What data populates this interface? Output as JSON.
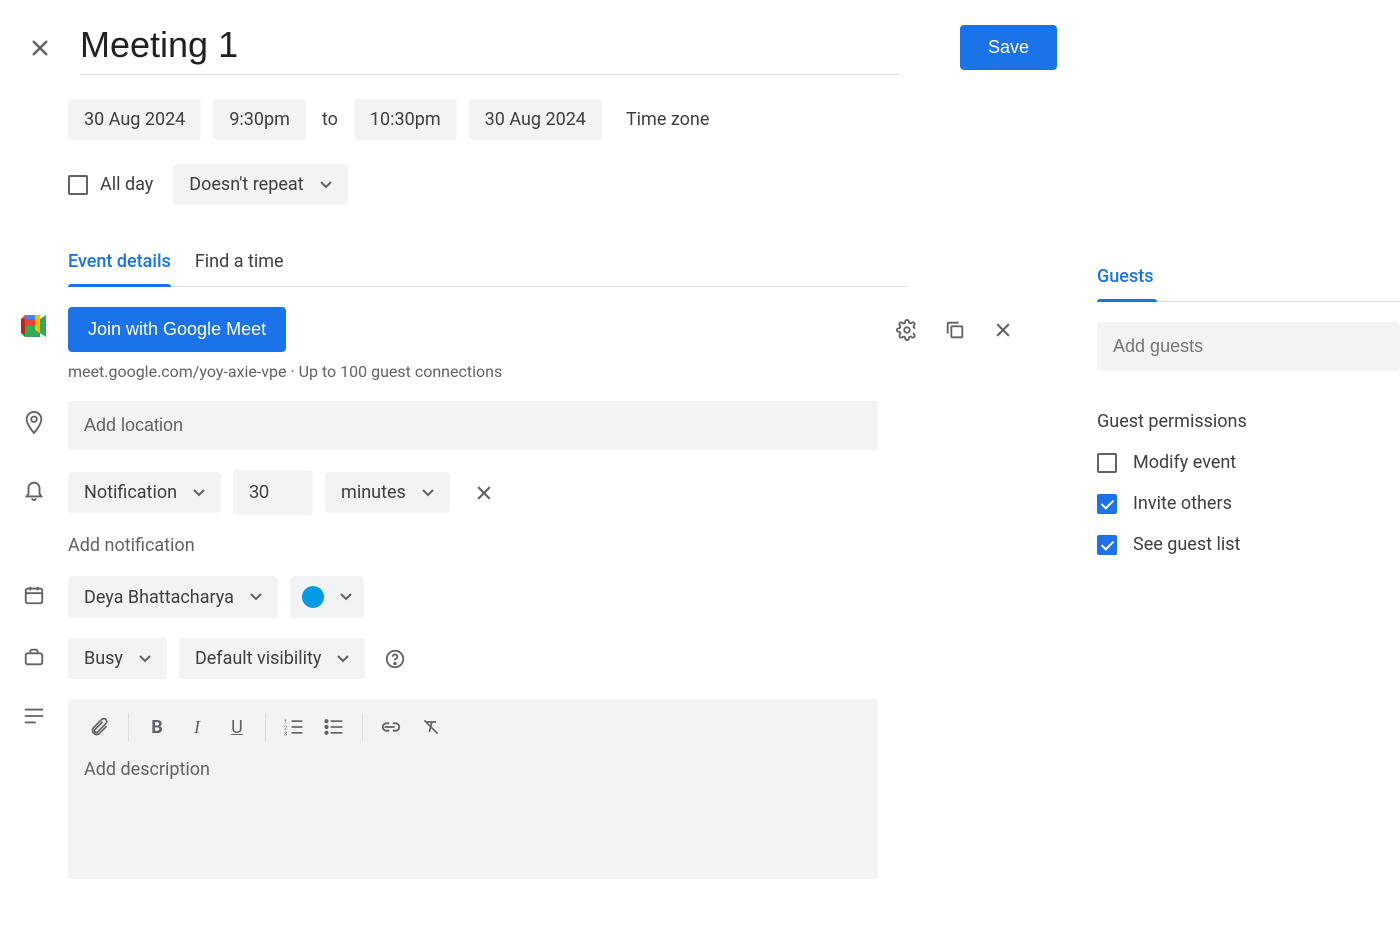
{
  "header": {
    "title": "Meeting 1",
    "save_label": "Save"
  },
  "datetime": {
    "start_date": "30 Aug 2024",
    "start_time": "9:30pm",
    "to_label": "to",
    "end_time": "10:30pm",
    "end_date": "30 Aug 2024",
    "timezone_label": "Time zone"
  },
  "allday": {
    "label": "All day",
    "checked": false
  },
  "recurrence": {
    "label": "Doesn't repeat"
  },
  "tabs": {
    "event_details": "Event details",
    "find_a_time": "Find a time"
  },
  "meet": {
    "button_label": "Join with Google Meet",
    "link_text": "meet.google.com/yoy-axie-vpe",
    "capacity_text": "Up to 100 guest connections"
  },
  "location": {
    "placeholder": "Add location"
  },
  "notification": {
    "type_label": "Notification",
    "value": "30",
    "unit_label": "minutes",
    "add_label": "Add notification"
  },
  "calendar": {
    "owner": "Deya Bhattacharya",
    "color": "#039be5"
  },
  "availability": {
    "busy_label": "Busy",
    "visibility_label": "Default visibility"
  },
  "description": {
    "placeholder": "Add description"
  },
  "guests": {
    "tab_label": "Guests",
    "input_placeholder": "Add guests",
    "permissions_title": "Guest permissions",
    "perms": {
      "modify": {
        "label": "Modify event",
        "checked": false
      },
      "invite": {
        "label": "Invite others",
        "checked": true
      },
      "seelist": {
        "label": "See guest list",
        "checked": true
      }
    }
  }
}
